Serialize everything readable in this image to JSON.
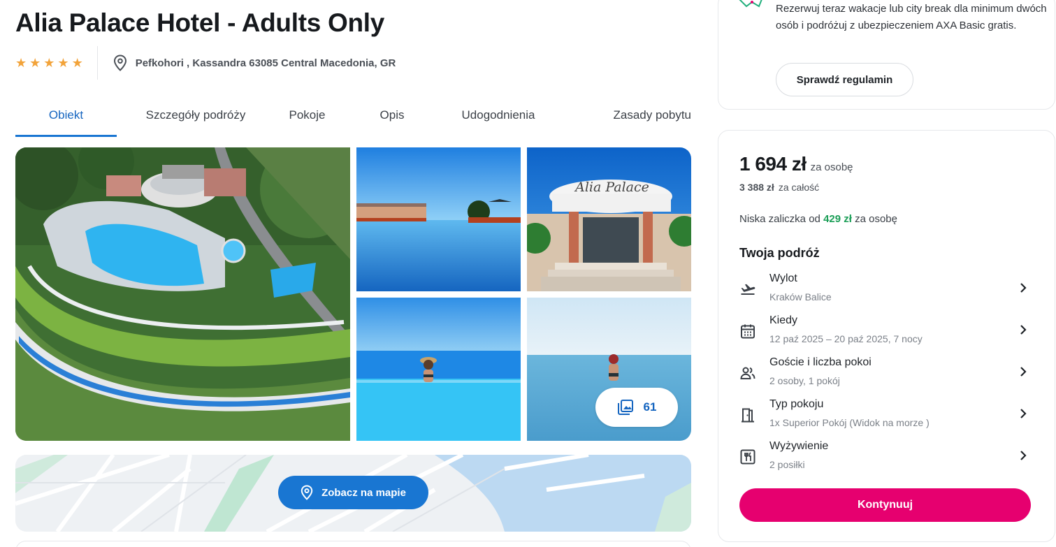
{
  "hotel": {
    "title": "Alia Palace Hotel - Adults Only",
    "stars": 5,
    "location": "Pefkohori , Kassandra 63085 Central Macedonia, GR"
  },
  "tabs": [
    {
      "label": "Obiekt",
      "active": true
    },
    {
      "label": "Szczegóły podróży",
      "active": false
    },
    {
      "label": "Pokoje",
      "active": false
    },
    {
      "label": "Opis",
      "active": false
    },
    {
      "label": "Udogodnienia",
      "active": false
    },
    {
      "label": "Zasady pobytu",
      "active": false
    }
  ],
  "gallery": {
    "photo_count": "61",
    "sign_text": "Alia Palace"
  },
  "map": {
    "button_label": "Zobacz na mapie"
  },
  "promo": {
    "text": "Rezerwuj teraz wakacje lub city break dla minimum dwóch osób i podróżuj z ubezpieczeniem AXA Basic gratis.",
    "button_label": "Sprawdź regulamin"
  },
  "booking": {
    "price": "1 694 zł",
    "price_per": "za osobę",
    "total": "3 388 zł",
    "total_label": "za całość",
    "deposit_prefix": "Niska zaliczka od",
    "deposit_amount": "429 zł",
    "deposit_suffix": "za osobę",
    "trip_title": "Twoja podróż",
    "items": [
      {
        "label": "Wylot",
        "value": "Kraków Balice",
        "icon": "plane-departure-icon"
      },
      {
        "label": "Kiedy",
        "value": "12 paź 2025 – 20 paź 2025, 7 nocy",
        "icon": "calendar-icon"
      },
      {
        "label": "Goście i liczba pokoi",
        "value": "2 osoby, 1 pokój",
        "icon": "guests-icon"
      },
      {
        "label": "Typ pokoju",
        "value": "1x Superior Pokój (Widok na morze )",
        "icon": "door-icon"
      },
      {
        "label": "Wyżywienie",
        "value": "2 posiłki",
        "icon": "cutlery-icon"
      }
    ],
    "continue_label": "Kontynuuj"
  },
  "colors": {
    "accent_blue": "#1976d2",
    "cta_pink": "#e6006f",
    "star": "#f2a33a",
    "deposit_green": "#1b9e57"
  }
}
